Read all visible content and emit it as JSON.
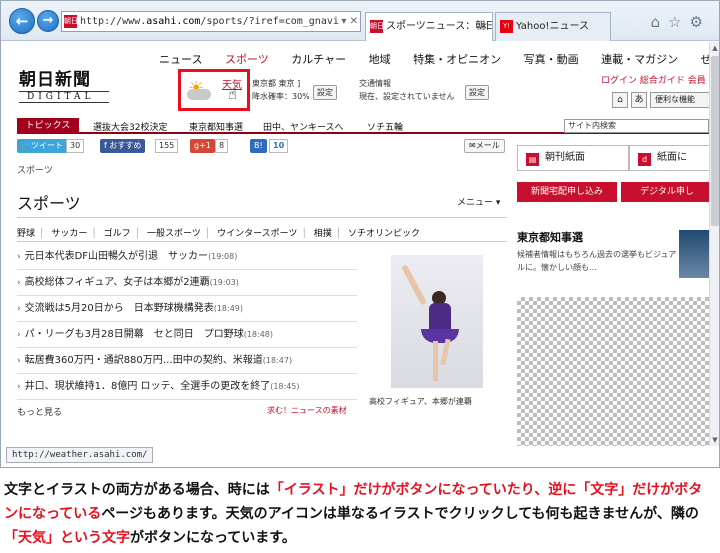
{
  "browser": {
    "back_label": "←",
    "forward_label": "→",
    "address_prefix": "http://www.",
    "address_host": "asahi.com",
    "address_path": "/sports/?iref=com_gnavi",
    "address_tools": "▾ ✕",
    "favicon_label": "朝日",
    "tabs": [
      {
        "label": "スポーツニュース：朝日新...",
        "favicon": "朝日",
        "close": "×"
      },
      {
        "label": "Yahoo!ニュース",
        "favicon": "Y!"
      }
    ],
    "tool_icons": "⌂☆⚙",
    "status_url": "http://weather.asahi.com/"
  },
  "header": {
    "logo_main": "朝日新聞",
    "logo_sub": "DIGITAL",
    "nav": [
      "ニュース",
      "スポーツ",
      "カルチャー",
      "地域",
      "特集・オピニオン",
      "写真・動画",
      "連載・マガジン",
      "ぜん"
    ],
    "weather_link": "天気",
    "weather_city": "東京都 東京 ]",
    "weather_rain": "降水確率：30%",
    "setting_label": "設定",
    "traffic_title": "交通情報",
    "traffic_text": "現在、設定されていません",
    "login_text": "ログイン 総合ガイド 会員",
    "home_icon": "⌂",
    "font_icon": "あ",
    "tools_label": "便利な機能"
  },
  "topics": {
    "label": "トピックス",
    "items": [
      "選抜大会32校決定",
      "東京都知事選",
      "田中、ヤンキースへ",
      "ソチ五輪"
    ],
    "search_placeholder": "サイト内検索"
  },
  "social": {
    "tweet_label": "ツイート",
    "tweet_count": "30",
    "fb_label": "おすすめ",
    "fb_count": "155",
    "gplus_label": "g+1",
    "gplus_count": "8",
    "hatena_label": "B!",
    "hatena_count": "10",
    "mail_label": "メール"
  },
  "main": {
    "breadcrumb": "スポーツ",
    "title": "スポーツ",
    "menu_label": "メニュー ▾",
    "subnav": [
      "野球",
      "サッカー",
      "ゴルフ",
      "一般スポーツ",
      "ウインタースポーツ",
      "相撲",
      "ソチオリンピック"
    ],
    "news": [
      {
        "title": "元日本代表DF山田暢久が引退　サッカー",
        "time": "(19:08)"
      },
      {
        "title": "高校総体フィギュア、女子は本郷が2連覇",
        "time": "(19:03)"
      },
      {
        "title": "交流戦は5月20日から　日本野球機構発表",
        "time": "(18:49)"
      },
      {
        "title": "パ・リーグも3月28日開幕　セと同日　プロ野球",
        "time": "(18:48)"
      },
      {
        "title": "転居費360万円・通訳880万円…田中の契約、米報道",
        "time": "(18:47)"
      },
      {
        "title": "井口、現状維持1．8億円 ロッテ、全選手の更改を終了",
        "time": "(18:45)"
      }
    ],
    "more_label": "もっと見る",
    "badge_caption": "求む！ニュースの素材",
    "photo_caption": "高校フィギュア、本郷が連覇"
  },
  "right": {
    "paper_label": "朝刊紙面",
    "paper2_label": "紙面に",
    "subscribe_label": "新聞宅配申し込み",
    "digital_label": "デジタル申し",
    "section_title": "東京都知事選",
    "section_text": "候補者情報はもちろん過去の選挙もビジュアルに。懐かしい顔も…"
  },
  "caption": {
    "parts": [
      {
        "text": "文字とイラストの両方がある場合、時には",
        "red": false
      },
      {
        "text": "「イラスト」だけがボタンになっていたり、逆に「文字」だけがボタンになっている",
        "red": true
      },
      {
        "text": "ページもあります。天気のアイコンは単なるイラストでクリックしても何も起きませんが、隣の",
        "red": false
      },
      {
        "text": "「天気」という文字",
        "red": true
      },
      {
        "text": "がボタンになっています。",
        "red": false
      }
    ]
  },
  "colors": {
    "brand_red": "#c8102e",
    "highlight_red": "#e8101e"
  }
}
